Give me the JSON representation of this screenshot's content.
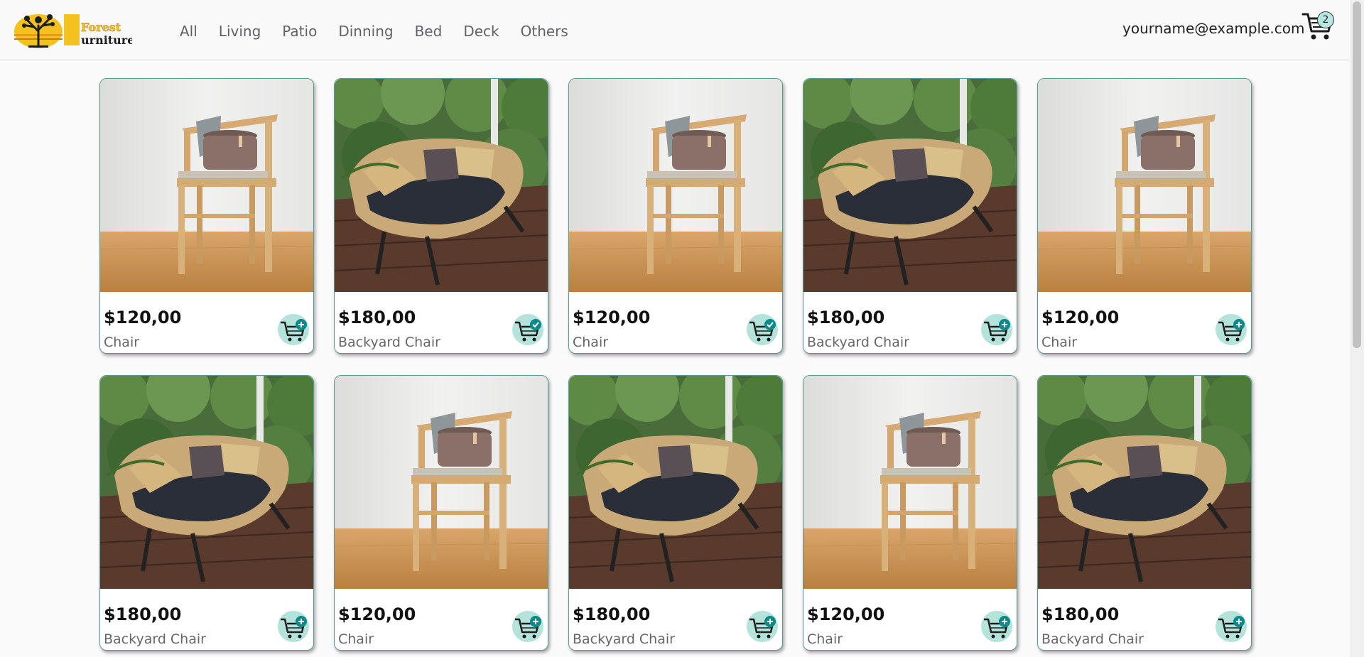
{
  "brand": {
    "logo_line1": "Forest",
    "logo_line2": "urniture",
    "logo_initial": "F"
  },
  "nav": {
    "links": [
      "All",
      "Living",
      "Patio",
      "Dinning",
      "Bed",
      "Deck",
      "Others"
    ]
  },
  "user": {
    "email": "yourname@example.com"
  },
  "cart": {
    "count": "2"
  },
  "products": [
    {
      "price": "$120,00",
      "name": "Chair",
      "image": "wooden-chair",
      "in_cart": false
    },
    {
      "price": "$180,00",
      "name": "Backyard Chair",
      "image": "rattan-chair",
      "in_cart": true
    },
    {
      "price": "$120,00",
      "name": "Chair",
      "image": "wooden-chair",
      "in_cart": true
    },
    {
      "price": "$180,00",
      "name": "Backyard Chair",
      "image": "rattan-chair",
      "in_cart": false
    },
    {
      "price": "$120,00",
      "name": "Chair",
      "image": "wooden-chair",
      "in_cart": false
    },
    {
      "price": "$180,00",
      "name": "Backyard Chair",
      "image": "rattan-chair",
      "in_cart": false
    },
    {
      "price": "$120,00",
      "name": "Chair",
      "image": "wooden-chair",
      "in_cart": false
    },
    {
      "price": "$180,00",
      "name": "Backyard Chair",
      "image": "rattan-chair",
      "in_cart": false
    },
    {
      "price": "$120,00",
      "name": "Chair",
      "image": "wooden-chair",
      "in_cart": false
    },
    {
      "price": "$180,00",
      "name": "Backyard Chair",
      "image": "rattan-chair",
      "in_cart": false
    }
  ],
  "colors": {
    "accent": "#b3e3db",
    "card_border": "#5a9a90",
    "plus_icon": "#0a8a8a"
  }
}
